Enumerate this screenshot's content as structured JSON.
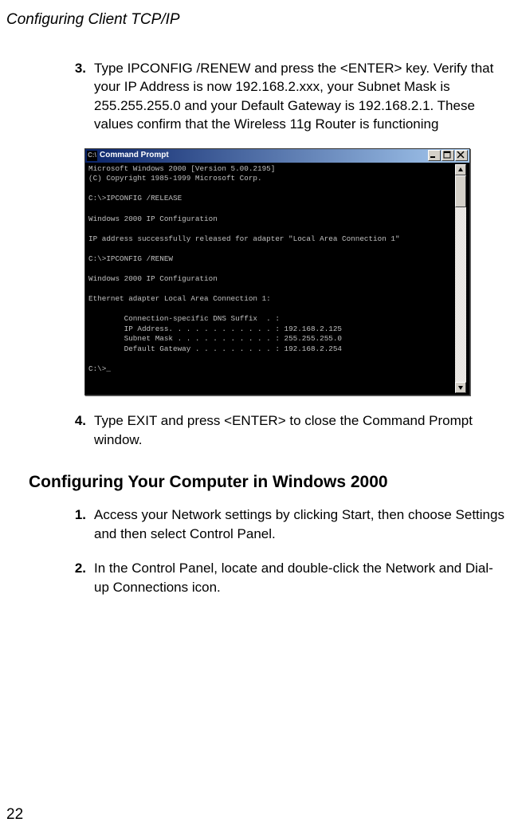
{
  "page_header": "Configuring Client TCP/IP",
  "page_number": "22",
  "steps_a": [
    {
      "num": "3.",
      "text": "Type IPCONFIG /RENEW and press the <ENTER> key. Verify that your IP Address is now 192.168.2.xxx, your Subnet Mask is 255.255.255.0 and your Default Gateway is 192.168.2.1. These values confirm that the Wireless 11g Router is functioning"
    }
  ],
  "steps_b": [
    {
      "num": "4.",
      "text": "Type EXIT and press <ENTER> to close the Command Prompt window."
    }
  ],
  "section_heading": "Configuring Your Computer in Windows 2000",
  "steps_c": [
    {
      "num": "1.",
      "text": "Access your Network settings by clicking Start, then choose Settings and then select Control Panel."
    },
    {
      "num": "2.",
      "text": "In the Control Panel, locate and double-click the Network and Dial-up Connections icon."
    }
  ],
  "console": {
    "title_icon": "C:\\",
    "title": "Command Prompt",
    "lines": [
      "Microsoft Windows 2000 [Version 5.00.2195]",
      "(C) Copyright 1985-1999 Microsoft Corp.",
      "",
      "C:\\>IPCONFIG /RELEASE",
      "",
      "Windows 2000 IP Configuration",
      "",
      "IP address successfully released for adapter \"Local Area Connection 1\"",
      "",
      "C:\\>IPCONFIG /RENEW",
      "",
      "Windows 2000 IP Configuration",
      "",
      "Ethernet adapter Local Area Connection 1:",
      "",
      "        Connection-specific DNS Suffix  . :",
      "        IP Address. . . . . . . . . . . . : 192.168.2.125",
      "        Subnet Mask . . . . . . . . . . . : 255.255.255.0",
      "        Default Gateway . . . . . . . . . : 192.168.2.254",
      "",
      "C:\\>_"
    ]
  }
}
